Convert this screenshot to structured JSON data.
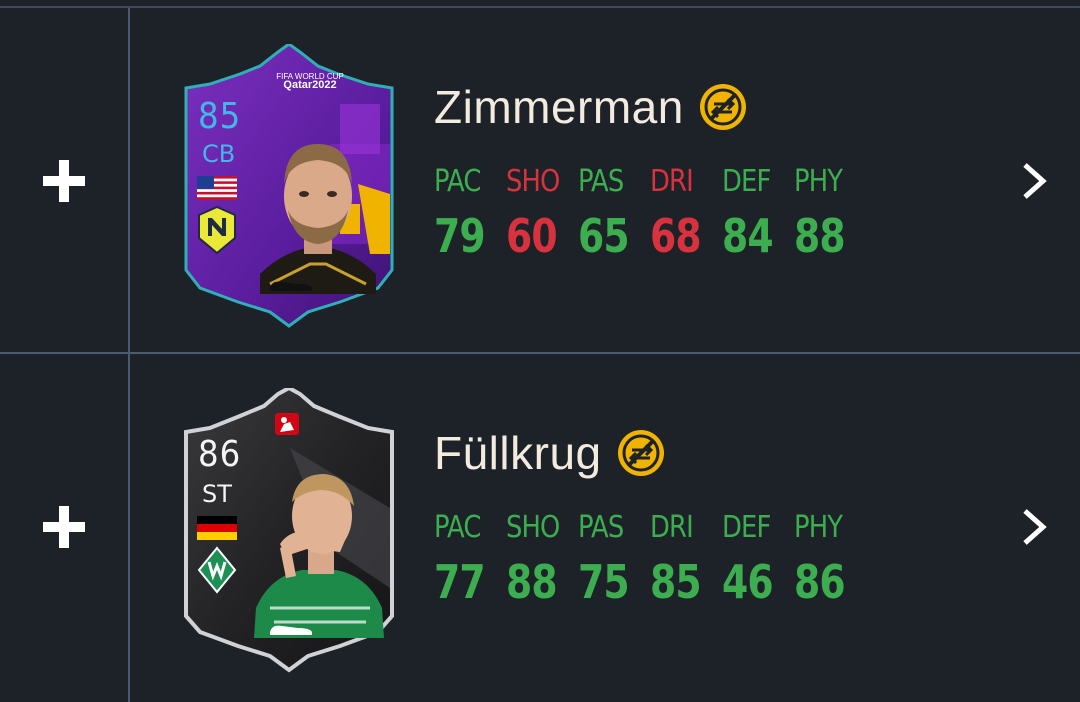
{
  "players": [
    {
      "name": "Zimmerman",
      "card": {
        "rating": "85",
        "position": "CB",
        "event_logo_line1": "FIFA WORLD CUP",
        "event_logo_line2": "Qatar2022",
        "nation_icon": "usa-flag-icon",
        "club_icon": "nashville-sc-crest-icon",
        "style": "world-cup-path-to-glory-purple"
      },
      "stats": [
        {
          "label": "PAC",
          "value": "79",
          "status": "good"
        },
        {
          "label": "SHO",
          "value": "60",
          "status": "bad"
        },
        {
          "label": "PAS",
          "value": "65",
          "status": "good"
        },
        {
          "label": "DRI",
          "value": "68",
          "status": "bad"
        },
        {
          "label": "DEF",
          "value": "84",
          "status": "good"
        },
        {
          "label": "PHY",
          "value": "88",
          "status": "good"
        }
      ]
    },
    {
      "name": "Füllkrug",
      "card": {
        "rating": "86",
        "position": "ST",
        "nation_icon": "germany-flag-icon",
        "club_icon": "werder-bremen-crest-icon",
        "league_icon": "bundesliga-logo-icon",
        "style": "dark-silver"
      },
      "stats": [
        {
          "label": "PAC",
          "value": "77",
          "status": "good"
        },
        {
          "label": "SHO",
          "value": "88",
          "status": "good"
        },
        {
          "label": "PAS",
          "value": "75",
          "status": "good"
        },
        {
          "label": "DRI",
          "value": "85",
          "status": "good"
        },
        {
          "label": "DEF",
          "value": "46",
          "status": "good"
        },
        {
          "label": "PHY",
          "value": "86",
          "status": "good"
        }
      ]
    }
  ],
  "icons": {
    "add": "plus-icon",
    "chemistry": "chemistry-swap-icon",
    "open": "chevron-right-icon"
  },
  "colors": {
    "background": "#1d2229",
    "divider": "#4a5a70",
    "good_stat": "#3dae4f",
    "bad_stat": "#d8323e",
    "name_text": "#f2ebde",
    "chem_badge": "#f0b400"
  }
}
